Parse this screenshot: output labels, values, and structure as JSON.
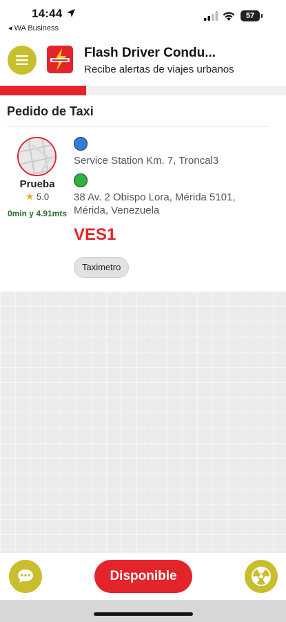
{
  "status_bar": {
    "time": "14:44",
    "back_app": "◂ WA Business",
    "battery": "57"
  },
  "header": {
    "title": "Flash Driver Condu...",
    "subtitle": "Recibe alertas de viajes urbanos",
    "logo_icon": "flash-logo-icon",
    "menu_icon": "hamburger-menu-icon",
    "progress": 0.3
  },
  "order": {
    "title": "Pedido de Taxi",
    "driver": {
      "name": "Prueba",
      "rating": "5.0",
      "eta": "0min y 4.91mts"
    },
    "origin": "Service Station Km. 7, Troncal3",
    "destination": "38 Av. 2 Obispo Lora, Mérida 5101, Mérida, Venezuela",
    "price": "VES1",
    "chip": "Taximetro"
  },
  "bottom": {
    "available_label": "Disponible",
    "chat_icon": "chat-bubble-icon",
    "sos_icon": "radiation-icon"
  },
  "colors": {
    "accent_red": "#e3242b",
    "olive_yellow": "#c9be2b",
    "origin_blue": "#2f7de1",
    "dest_green": "#2cb43b"
  }
}
